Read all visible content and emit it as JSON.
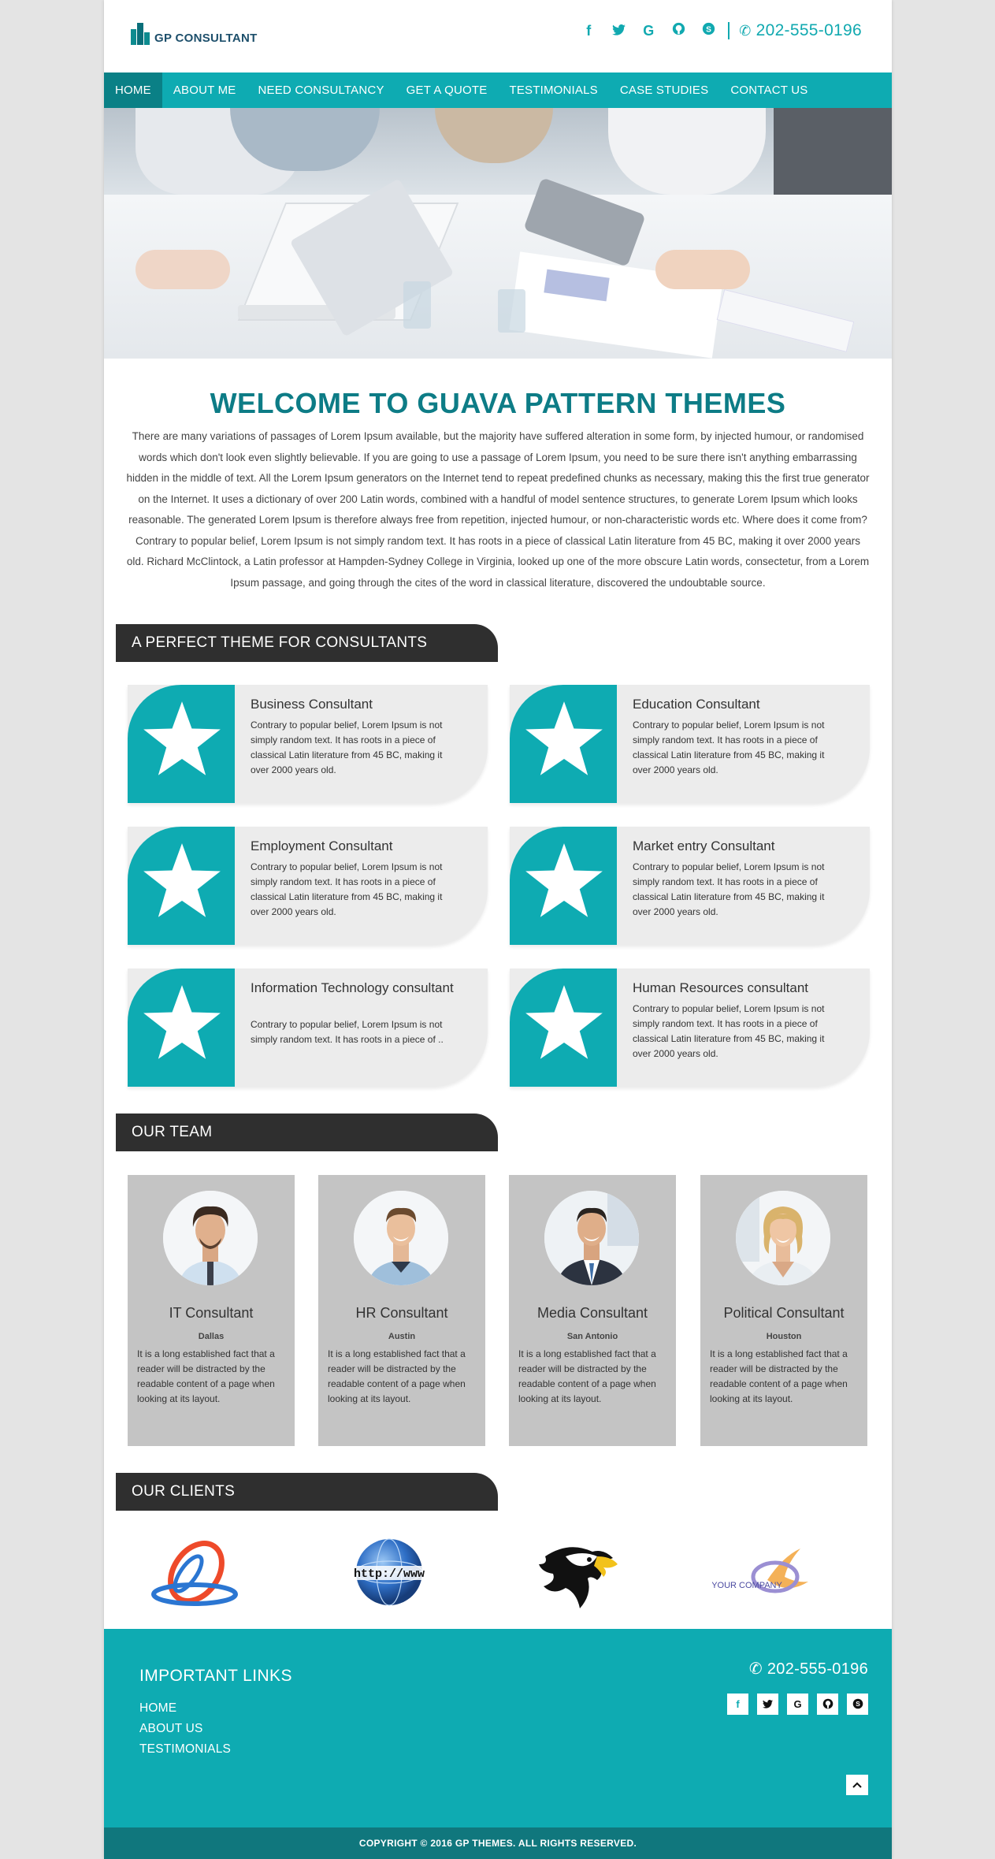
{
  "header": {
    "logo_text": "GP CONSULTANT",
    "social": [
      {
        "icon": "facebook-icon",
        "glyph": "f"
      },
      {
        "icon": "twitter-icon",
        "glyph": "t"
      },
      {
        "icon": "google-icon",
        "glyph": "G"
      },
      {
        "icon": "github-icon",
        "glyph": "◕"
      },
      {
        "icon": "skype-icon",
        "glyph": "S"
      }
    ],
    "phone": "202-555-0196"
  },
  "nav": {
    "items": [
      "HOME",
      "ABOUT ME",
      "NEED CONSULTANCY",
      "GET A QUOTE",
      "TESTIMONIALS",
      "CASE STUDIES",
      "CONTACT US"
    ],
    "active": "HOME"
  },
  "welcome": {
    "title": "WELCOME TO GUAVA PATTERN THEMES",
    "text": "There are many variations of passages of Lorem Ipsum available, but the majority have suffered alteration in some form, by injected humour, or randomised words which don't look even slightly believable. If you are going to use a passage of Lorem Ipsum, you need to be sure there isn't anything embarrassing hidden in the middle of text. All the Lorem Ipsum generators on the Internet tend to repeat predefined chunks as necessary, making this the first true generator on the Internet. It uses a dictionary of over 200 Latin words, combined with a handful of model sentence structures, to generate Lorem Ipsum which looks reasonable. The generated Lorem Ipsum is therefore always free from repetition, injected humour, or non-characteristic words etc. Where does it come from?Contrary to popular belief, Lorem Ipsum is not simply random text. It has roots in a piece of classical Latin literature from 45 BC, making it over 2000 years old. Richard McClintock, a Latin professor at Hampden-Sydney College in Virginia, looked up one of the more obscure Latin words, consectetur, from a Lorem Ipsum passage, and going through the cites of the word in classical literature, discovered the undoubtable source."
  },
  "services": {
    "heading": "A PERFECT THEME FOR CONSULTANTS",
    "items": [
      {
        "title": "Business Consultant",
        "desc": "Contrary to popular belief, Lorem Ipsum is not simply random text. It has roots in a piece of classical Latin literature from 45 BC, making it over 2000 years old."
      },
      {
        "title": "Education Consultant",
        "desc": "Contrary to popular belief, Lorem Ipsum is not simply random text. It has roots in a piece of classical Latin literature from 45 BC, making it over 2000 years old."
      },
      {
        "title": "Employment Consultant",
        "desc": "Contrary to popular belief, Lorem Ipsum is not simply random text. It has roots in a piece of classical Latin literature from 45 BC, making it over 2000 years old."
      },
      {
        "title": "Market entry Consultant",
        "desc": "Contrary to popular belief, Lorem Ipsum is not simply random text. It has roots in a piece of classical Latin literature from 45 BC, making it over 2000 years old."
      },
      {
        "title": "Information Technology consultant",
        "desc": "Contrary to popular belief, Lorem Ipsum is not simply random text. It has roots in a piece of .."
      },
      {
        "title": "Human Resources consultant",
        "desc": "Contrary to popular belief, Lorem Ipsum is not simply random text. It has roots in a piece of classical Latin literature from 45 BC, making it over 2000 years old."
      }
    ]
  },
  "team": {
    "heading": "OUR TEAM",
    "members": [
      {
        "role": "IT Consultant",
        "city": "Dallas",
        "desc": "It is a long established fact that a reader will be distracted by the readable content of a page when looking at its layout."
      },
      {
        "role": "HR Consultant",
        "city": "Austin",
        "desc": "It is a long established fact that a reader will be distracted by the readable content of a page when looking at its layout."
      },
      {
        "role": "Media Consultant",
        "city": "San Antonio",
        "desc": "It is a long established fact that a reader will be distracted by the readable content of a page when looking at its layout."
      },
      {
        "role": "Political Consultant",
        "city": "Houston",
        "desc": "It is a long established fact that a reader will be distracted by the readable content of a page when looking at its layout."
      }
    ]
  },
  "clients": {
    "heading": "OUR CLIENTS",
    "logos": [
      {
        "icon": "swirl-logo-icon"
      },
      {
        "icon": "globe-www-logo-icon",
        "text": "http://www"
      },
      {
        "icon": "eagle-logo-icon"
      },
      {
        "icon": "your-company-logo-icon",
        "text": "YOUR COMPANY"
      }
    ]
  },
  "footer": {
    "title": "IMPORTANT LINKS",
    "links": [
      "HOME",
      "ABOUT US",
      "TESTIMONIALS"
    ],
    "phone": "202-555-0196",
    "social": [
      {
        "icon": "facebook-icon",
        "glyph": "f"
      },
      {
        "icon": "twitter-icon",
        "glyph": "t"
      },
      {
        "icon": "google-icon",
        "glyph": "G"
      },
      {
        "icon": "github-icon",
        "glyph": "◕"
      },
      {
        "icon": "skype-icon",
        "glyph": "S"
      }
    ],
    "to_top_icon": "chevron-up-icon",
    "copyright": "COPYRIGHT © 2016 GP THEMES. ALL RIGHTS RESERVED."
  },
  "colors": {
    "accent": "#0eabb2",
    "accent_dark": "#0a8086",
    "heading_dark": "#2f2f2f",
    "card_bg": "#ececec",
    "team_card_bg": "#c4c4c4"
  }
}
